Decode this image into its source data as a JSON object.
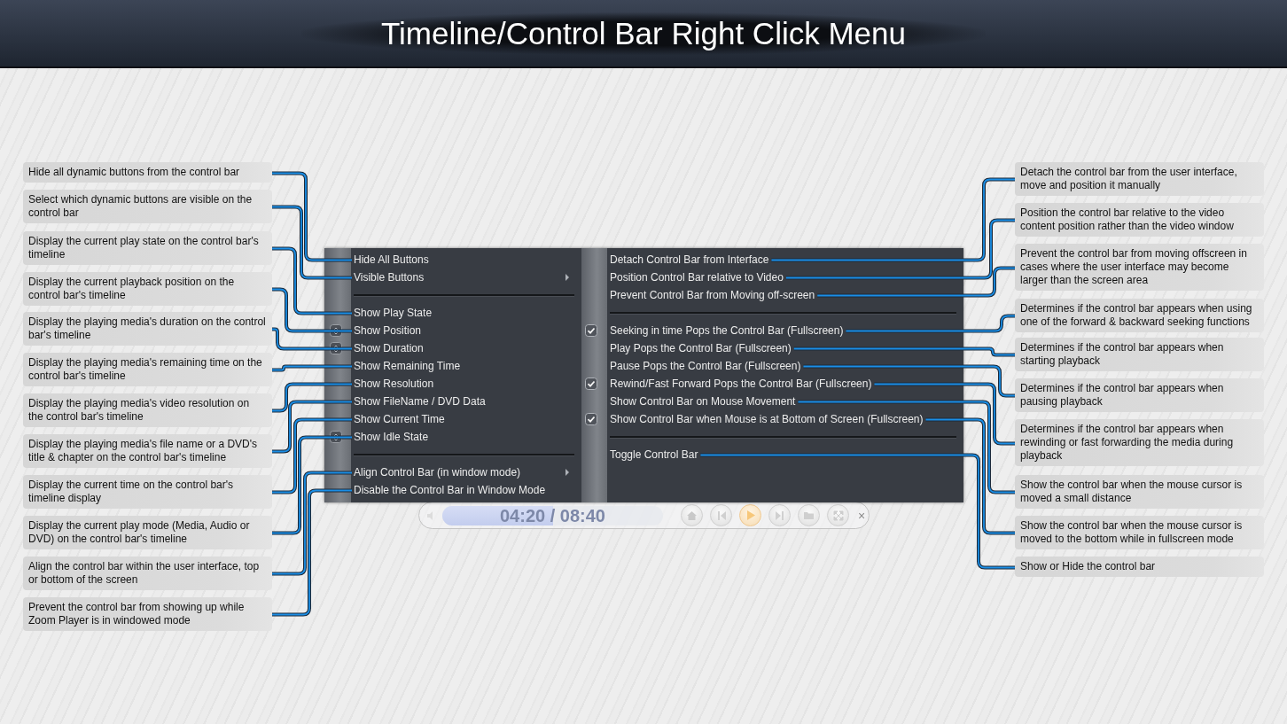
{
  "title": "Timeline/Control Bar Right Click Menu",
  "left_notes": [
    {
      "text": "Hide all dynamic buttons from the control bar"
    },
    {
      "text": "Select which dynamic buttons are visible on the control bar"
    },
    {
      "text": "Display the current play state on the control bar's timeline"
    },
    {
      "text": "Display the current playback position on the control bar's timeline"
    },
    {
      "text": "Display the playing media's duration on the control bar's timeline"
    },
    {
      "text": "Display the playing media's remaining time on the control bar's timeline"
    },
    {
      "text": "Display the playing media's video resolution on the control bar's timeline"
    },
    {
      "text": "Display the playing media's file name or a DVD's title & chapter on the control bar's timeline"
    },
    {
      "text": "Display the current time on the control bar's timeline display"
    },
    {
      "text": "Display the current play mode (Media, Audio or DVD) on the control bar's timeline"
    },
    {
      "text": "Align the control bar within the user interface, top or bottom of the screen"
    },
    {
      "text": "Prevent the control bar from showing up while Zoom Player is in windowed mode"
    }
  ],
  "menu": {
    "left": [
      {
        "kind": "item",
        "label": "Hide All Buttons",
        "checked": false,
        "submenu": false
      },
      {
        "kind": "item",
        "label": "Visible Buttons",
        "checked": false,
        "submenu": true
      },
      {
        "kind": "separator"
      },
      {
        "kind": "item",
        "label": "Show Play State",
        "checked": false,
        "submenu": false
      },
      {
        "kind": "item",
        "label": "Show Position",
        "checked": true,
        "submenu": false
      },
      {
        "kind": "item",
        "label": "Show Duration",
        "checked": true,
        "submenu": false
      },
      {
        "kind": "item",
        "label": "Show Remaining Time",
        "checked": false,
        "submenu": false
      },
      {
        "kind": "item",
        "label": "Show Resolution",
        "checked": false,
        "submenu": false
      },
      {
        "kind": "item",
        "label": "Show FileName / DVD Data",
        "checked": false,
        "submenu": false
      },
      {
        "kind": "item",
        "label": "Show Current Time",
        "checked": false,
        "submenu": false
      },
      {
        "kind": "item",
        "label": "Show Idle State",
        "checked": true,
        "submenu": false
      },
      {
        "kind": "separator"
      },
      {
        "kind": "item",
        "label": "Align Control Bar (in window mode)",
        "checked": false,
        "submenu": true
      },
      {
        "kind": "item",
        "label": "Disable the Control Bar in Window Mode",
        "checked": false,
        "submenu": false
      }
    ],
    "right": [
      {
        "kind": "item",
        "label": "Detach Control Bar from Interface",
        "checked": false,
        "submenu": false
      },
      {
        "kind": "item",
        "label": "Position Control Bar relative to Video",
        "checked": false,
        "submenu": false
      },
      {
        "kind": "item",
        "label": "Prevent Control Bar from Moving off-screen",
        "checked": false,
        "submenu": false
      },
      {
        "kind": "separator"
      },
      {
        "kind": "item",
        "label": "Seeking in time Pops the Control Bar (Fullscreen)",
        "checked": true,
        "submenu": false
      },
      {
        "kind": "item",
        "label": "Play Pops the Control Bar (Fullscreen)",
        "checked": false,
        "submenu": false
      },
      {
        "kind": "item",
        "label": "Pause Pops the Control Bar (Fullscreen)",
        "checked": false,
        "submenu": false
      },
      {
        "kind": "item",
        "label": "Rewind/Fast Forward Pops the Control Bar (Fullscreen)",
        "checked": true,
        "submenu": false
      },
      {
        "kind": "item",
        "label": "Show Control Bar on Mouse Movement",
        "checked": false,
        "submenu": false
      },
      {
        "kind": "item",
        "label": "Show Control Bar when Mouse is at Bottom of Screen (Fullscreen)",
        "checked": true,
        "submenu": false
      },
      {
        "kind": "separator"
      },
      {
        "kind": "item",
        "label": "Toggle Control Bar",
        "checked": false,
        "submenu": false
      }
    ]
  },
  "right_notes": [
    {
      "text": "Detach the control bar from the user interface, move and position it manually"
    },
    {
      "text": "Position the control bar relative to the video content position rather than the video window"
    },
    {
      "text": "Prevent the control bar from moving offscreen in cases where the user interface may become larger than the screen area"
    },
    {
      "text": "Determines if the control bar appears when using one of the forward & backward seeking functions"
    },
    {
      "text": "Determines if the control bar appears when starting playback"
    },
    {
      "text": "Determines if the control bar appears when pausing playback"
    },
    {
      "text": "Determines if the control bar appears when rewinding or fast forwarding the media during playback"
    },
    {
      "text": "Show the control bar when the mouse cursor is moved a small distance"
    },
    {
      "text": "Show the control bar when the mouse cursor is moved to the bottom while in fullscreen mode"
    },
    {
      "text": "Show or Hide the control bar"
    }
  ],
  "control_bar": {
    "time": "04:20 / 08:40",
    "level": 0.5,
    "close": "×"
  }
}
